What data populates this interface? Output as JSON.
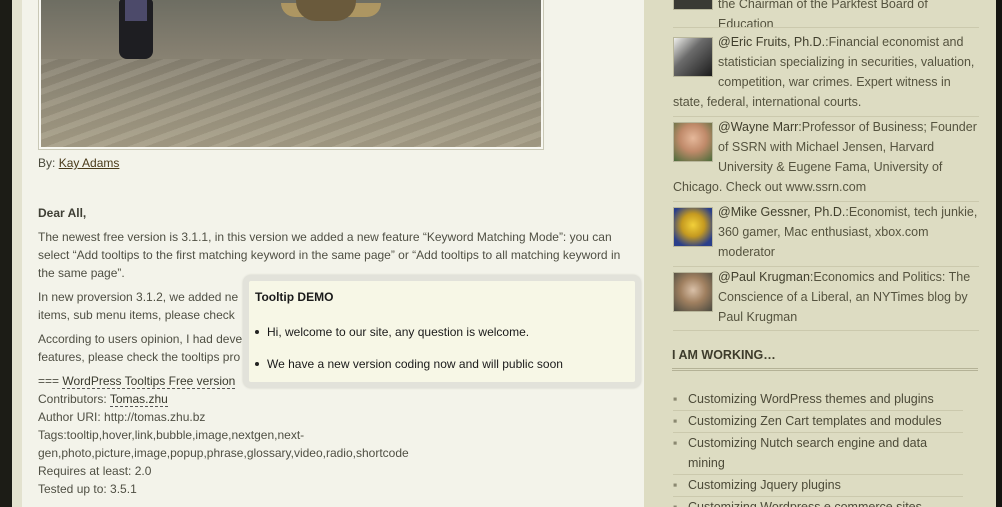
{
  "post": {
    "byline_prefix": "By:",
    "byline_author": "Kay Adams",
    "greeting": "Dear All,",
    "para1": "The newest free version is 3.1.1, in this version we added a new feature “Keyword Matching Mode”: you can select “Add tooltips to the first matching keyword in the same page” or “Add tooltips to all matching keyword in the same page”.",
    "para2_line1": "In new proversion 3.1.2, we added ne",
    "para2_line2": "items, sub menu items, please check",
    "para3_line1": "According to users opinion, I had deve",
    "para3_line2": "features, please check the tooltips pro",
    "header_prefix": "===",
    "header_link": "WordPress Tooltips Free version",
    "contributors_label": "Contributors:",
    "contributors_value": "Tomas.zhu",
    "author_uri": "Author URI: http://tomas.zhu.bz",
    "tags_line1": "Tags:tooltip,hover,link,bubble,image,nextgen,next-",
    "tags_line2": "gen,photo,picture,image,popup,phrase,glossary,video,radio,shortcode",
    "requires": "Requires at least: 2.0",
    "tested": "Tested up to: 3.5.1"
  },
  "tooltip": {
    "title": "Tooltip DEMO",
    "items": [
      "Hi, welcome to our site, any question is welcome.",
      "We have a new version coding now and will public soon"
    ]
  },
  "sidebar": {
    "top_fragment": "the Chairman of the Parkfest Board of Education",
    "people": [
      {
        "handle": "@Eric Fruits, Ph.D.",
        "desc": "Financial economist and statistician specializing in securities, valuation, competition, war crimes. Expert witness in state, federal, international courts."
      },
      {
        "handle": "@Wayne Marr",
        "desc": "Professor of Business; Founder of SSRN with Michael Jensen, Harvard University & Eugene Fama, University of Chicago. Check out www.ssrn.com"
      },
      {
        "handle": "@Mike Gessner, Ph.D.",
        "desc": "Economist, tech junkie, 360 gamer, Mac enthusiast, xbox.com moderator"
      },
      {
        "handle": "@Paul Krugman",
        "desc": "Economics and Politics: The Conscience of a Liberal, an NYTimes blog by Paul Krugman"
      }
    ],
    "working_title": "I AM WORKING…",
    "working_items": [
      "Customizing WordPress themes and plugins",
      "Customizing Zen Cart templates and modules",
      "Customizing Nutch search engine and data mining",
      "Customizing Jquery plugins",
      "Customizing Wordpress e commerce sites"
    ]
  }
}
